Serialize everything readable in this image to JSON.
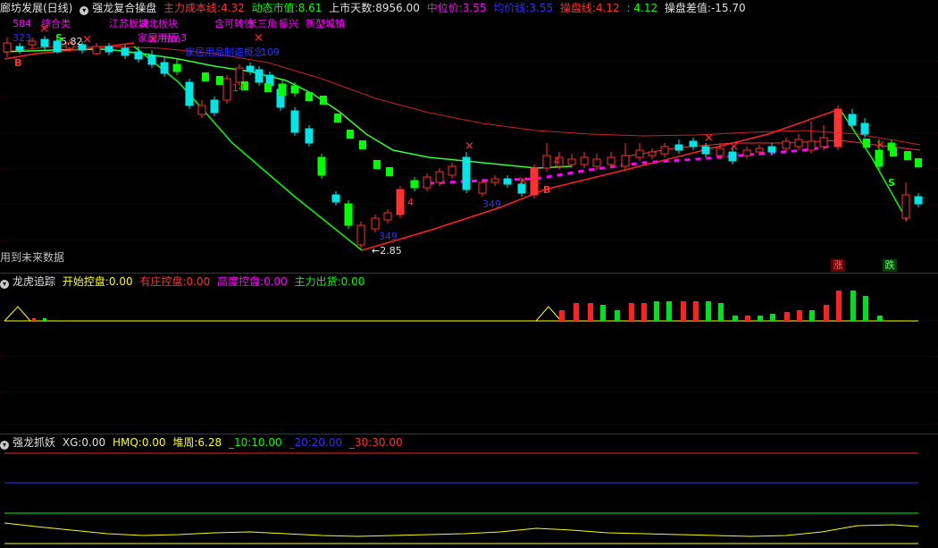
{
  "colors": {
    "up": "#ff3030",
    "down": "#00e5e5",
    "green": "#00ff00",
    "bright_green": "#33ff33",
    "red_line": "#ff2020",
    "magenta": "#ff00ff",
    "yellow": "#ffff00",
    "blue": "#3030ff",
    "white": "#ffffff",
    "divider": "#c00000"
  },
  "panel1": {
    "stock_name": "廊坊发展(日线)",
    "indicator_name": "强龙复合操盘",
    "main_cost_label": "主力成本线:",
    "main_cost_value": "4.32",
    "dyn_mktcap_label": "动态市值:",
    "dyn_mktcap_value": "8.61",
    "listed_days_label": "上市天数:",
    "listed_days_value": "8956.00",
    "median_label": "中位价:",
    "median_value": "3.55",
    "avg_label": "均价线:",
    "avg_value": "3.55",
    "op_line_label": "操盘线:",
    "op_line_value1": "4.12",
    "op_line_value2": "4.12",
    "op_diff_label": "操盘差值:",
    "op_diff_value": "-15.70",
    "future_note": "用到未来数据",
    "low_price_label": "2.85",
    "left_price_label": "5.82",
    "tags": {
      "t584": "584",
      "t_zonghe": "综合类",
      "t_jiangsu": "江苏板块",
      "t_hubei": "湖北板块",
      "t_jiaju": "家居用品",
      "t_yongpin3": "用品3",
      "t_jiaju2": "家居用品制造概念",
      "t_109": "109",
      "t_hanke": "含可转债",
      "t_changsanjiao": "长三角",
      "t_zhenxing": "振兴",
      "t_xinxing": "新型城镇",
      "t_323": "323",
      "t_14": "14",
      "t_349a": "349",
      "t_349b": "349",
      "t_4a": "4",
      "t_4b": "4",
      "s_label": "S",
      "b_label": "B",
      "x_label": "×"
    },
    "buttons": {
      "zhang": "涨",
      "die": "跌"
    }
  },
  "panel2": {
    "name": "龙虎追踪",
    "start_label": "开始控盘:",
    "start_value": "0.00",
    "zhuang_label": "有庄控盘:",
    "zhuang_value": "0.00",
    "high_label": "高度控盘:",
    "high_value": "0.00",
    "exit_label": "主力出货:",
    "exit_value": "0.00"
  },
  "panel3": {
    "name": "强龙抓妖",
    "xg_label": "XG:",
    "xg_value": "0.00",
    "hmq_label": "HMQ:",
    "hmq_value": "0.00",
    "duizhou_label": "堆周:",
    "duizhou_value": "6.28",
    "l10_label": "_10:",
    "l10_value": "10.00",
    "l20_label": "_20:",
    "l20_value": "20.00",
    "l30_label": "_30:",
    "l30_value": "30.00"
  }
}
